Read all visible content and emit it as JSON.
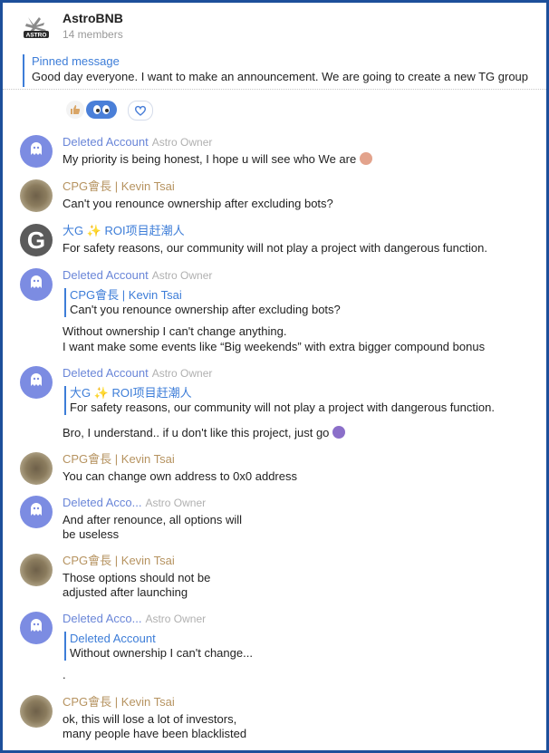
{
  "header": {
    "title": "AstroBNB",
    "members": "14 members"
  },
  "pinned": {
    "title": "Pinned message",
    "text": "Good day everyone. I want to make an announcement. We are going to create a new TG group"
  },
  "messages": [
    {
      "avatar": "ghost",
      "name": "Deleted Account",
      "role": "Astro Owner",
      "text": "My priority is being honest, I hope u will see who We are",
      "emoji": "face-emoji"
    },
    {
      "avatar": "cpg",
      "name": "CPG會長 | Kevin Tsai",
      "text": "Can't you renounce ownership after excluding bots?"
    },
    {
      "avatar": "g",
      "avatar_letter": "G",
      "name": "大G ✨ ROI项目赶潮人",
      "text": "For safety reasons, our community will not play a project with dangerous function."
    },
    {
      "avatar": "ghost",
      "name": "Deleted Account",
      "role": "Astro Owner",
      "quote_name": "CPG會長 | Kevin Tsai",
      "quote_text": "Can't you renounce ownership after excluding bots?",
      "lines": [
        "Without ownership I can't change anything.",
        "I want make some events like “Big weekends” with extra bigger compound bonus"
      ]
    },
    {
      "avatar": "ghost",
      "name": "Deleted Account",
      "role": "Astro Owner",
      "quote_name": "大G ✨ ROI项目赶潮人",
      "quote_text": "For safety reasons, our community will not play a project with dangerous function.",
      "text": "Bro, I understand.. if u don't like this project, just go",
      "emoji": "shrug-emoji"
    },
    {
      "avatar": "cpg",
      "name": "CPG會長 | Kevin Tsai",
      "text": "You can change own address to 0x0 address"
    },
    {
      "avatar": "ghost",
      "name": "Deleted Acco...",
      "role": "Astro Owner",
      "lines": [
        "And after renounce, all options will",
        "be useless"
      ]
    },
    {
      "avatar": "cpg",
      "name": "CPG會長 | Kevin Tsai",
      "lines": [
        "Those options should not be",
        "adjusted after launching"
      ]
    },
    {
      "avatar": "ghost",
      "name": "Deleted Acco...",
      "role": "Astro Owner",
      "quote_name": "Deleted Account",
      "quote_text": "Without ownership I can't change...",
      "text": "."
    },
    {
      "avatar": "cpg",
      "name": "CPG會長 | Kevin Tsai",
      "lines": [
        "ok, this will lose a lot of investors,",
        "many people have been blacklisted"
      ]
    }
  ],
  "colors": {
    "border": "#1d4f9a",
    "link_blue": "#3d7dd8",
    "deleted_name": "#6a86d8",
    "cpg_name": "#b69360"
  }
}
